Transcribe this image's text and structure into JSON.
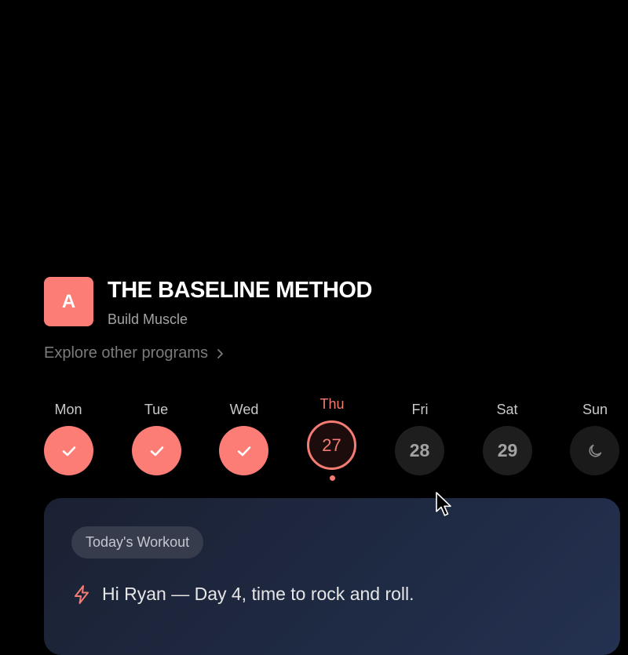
{
  "program": {
    "logo_letter": "A",
    "title": "THE BASELINE METHOD",
    "subtitle": "Build Muscle",
    "explore_label": "Explore other programs",
    "explore_icon": "chevron-right-icon"
  },
  "week": {
    "days": [
      {
        "label": "Mon",
        "state": "completed",
        "icon": "check-icon"
      },
      {
        "label": "Tue",
        "state": "completed",
        "icon": "check-icon"
      },
      {
        "label": "Wed",
        "state": "completed",
        "icon": "check-icon"
      },
      {
        "label": "Thu",
        "state": "today",
        "date": "27"
      },
      {
        "label": "Fri",
        "state": "upcoming",
        "date": "28"
      },
      {
        "label": "Sat",
        "state": "upcoming",
        "date": "29"
      },
      {
        "label": "Sun",
        "state": "rest",
        "icon": "moon-icon"
      }
    ]
  },
  "workout": {
    "badge": "Today's Workout",
    "icon": "lightning-icon",
    "greeting": "Hi Ryan — Day 4, time to rock and roll."
  },
  "colors": {
    "accent": "#fb7d76",
    "today": "#f47c73",
    "card": "#1f2a44"
  }
}
